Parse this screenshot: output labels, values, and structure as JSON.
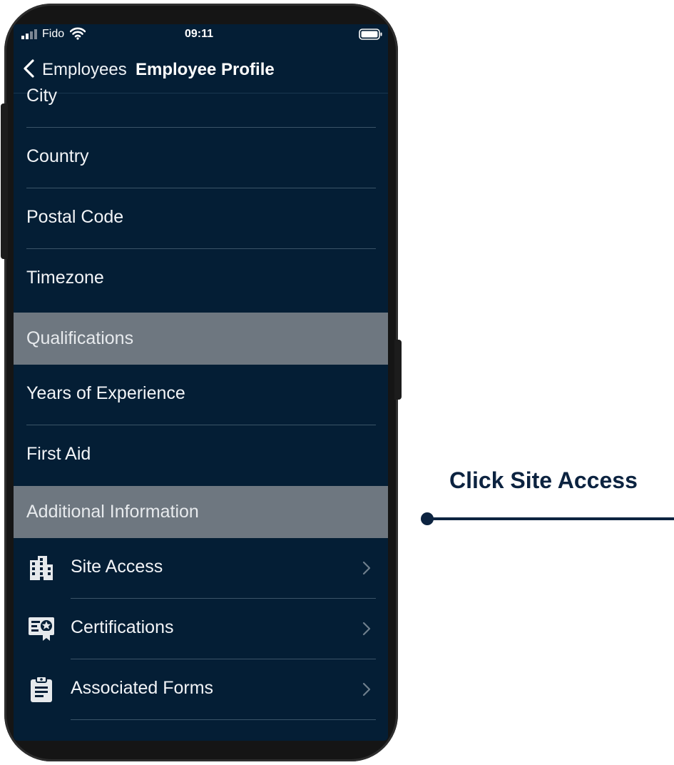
{
  "status_bar": {
    "carrier": "Fido",
    "time": "09:11",
    "signal_icon": "cell-signal-icon",
    "wifi_icon": "wifi-icon",
    "battery_icon": "battery-icon"
  },
  "nav": {
    "back_label": "Employees",
    "title": "Employee Profile",
    "back_icon": "chevron-left-icon"
  },
  "rows": {
    "city": "City",
    "country": "Country",
    "postal_code": "Postal Code",
    "timezone": "Timezone",
    "years_of_experience": "Years of Experience",
    "first_aid": "First Aid"
  },
  "sections": {
    "qualifications": "Qualifications",
    "additional_information": "Additional Information"
  },
  "nav_rows": [
    {
      "label": "Site Access",
      "icon": "building-icon"
    },
    {
      "label": "Certifications",
      "icon": "certificate-icon"
    },
    {
      "label": "Associated Forms",
      "icon": "clipboard-icon"
    }
  ],
  "annotation": {
    "callout": "Click Site Access"
  },
  "colors": {
    "screen_bg": "#041e35",
    "section_bg": "#6e7780",
    "callout_text": "#0c2340",
    "phone_frame": "#151515"
  }
}
